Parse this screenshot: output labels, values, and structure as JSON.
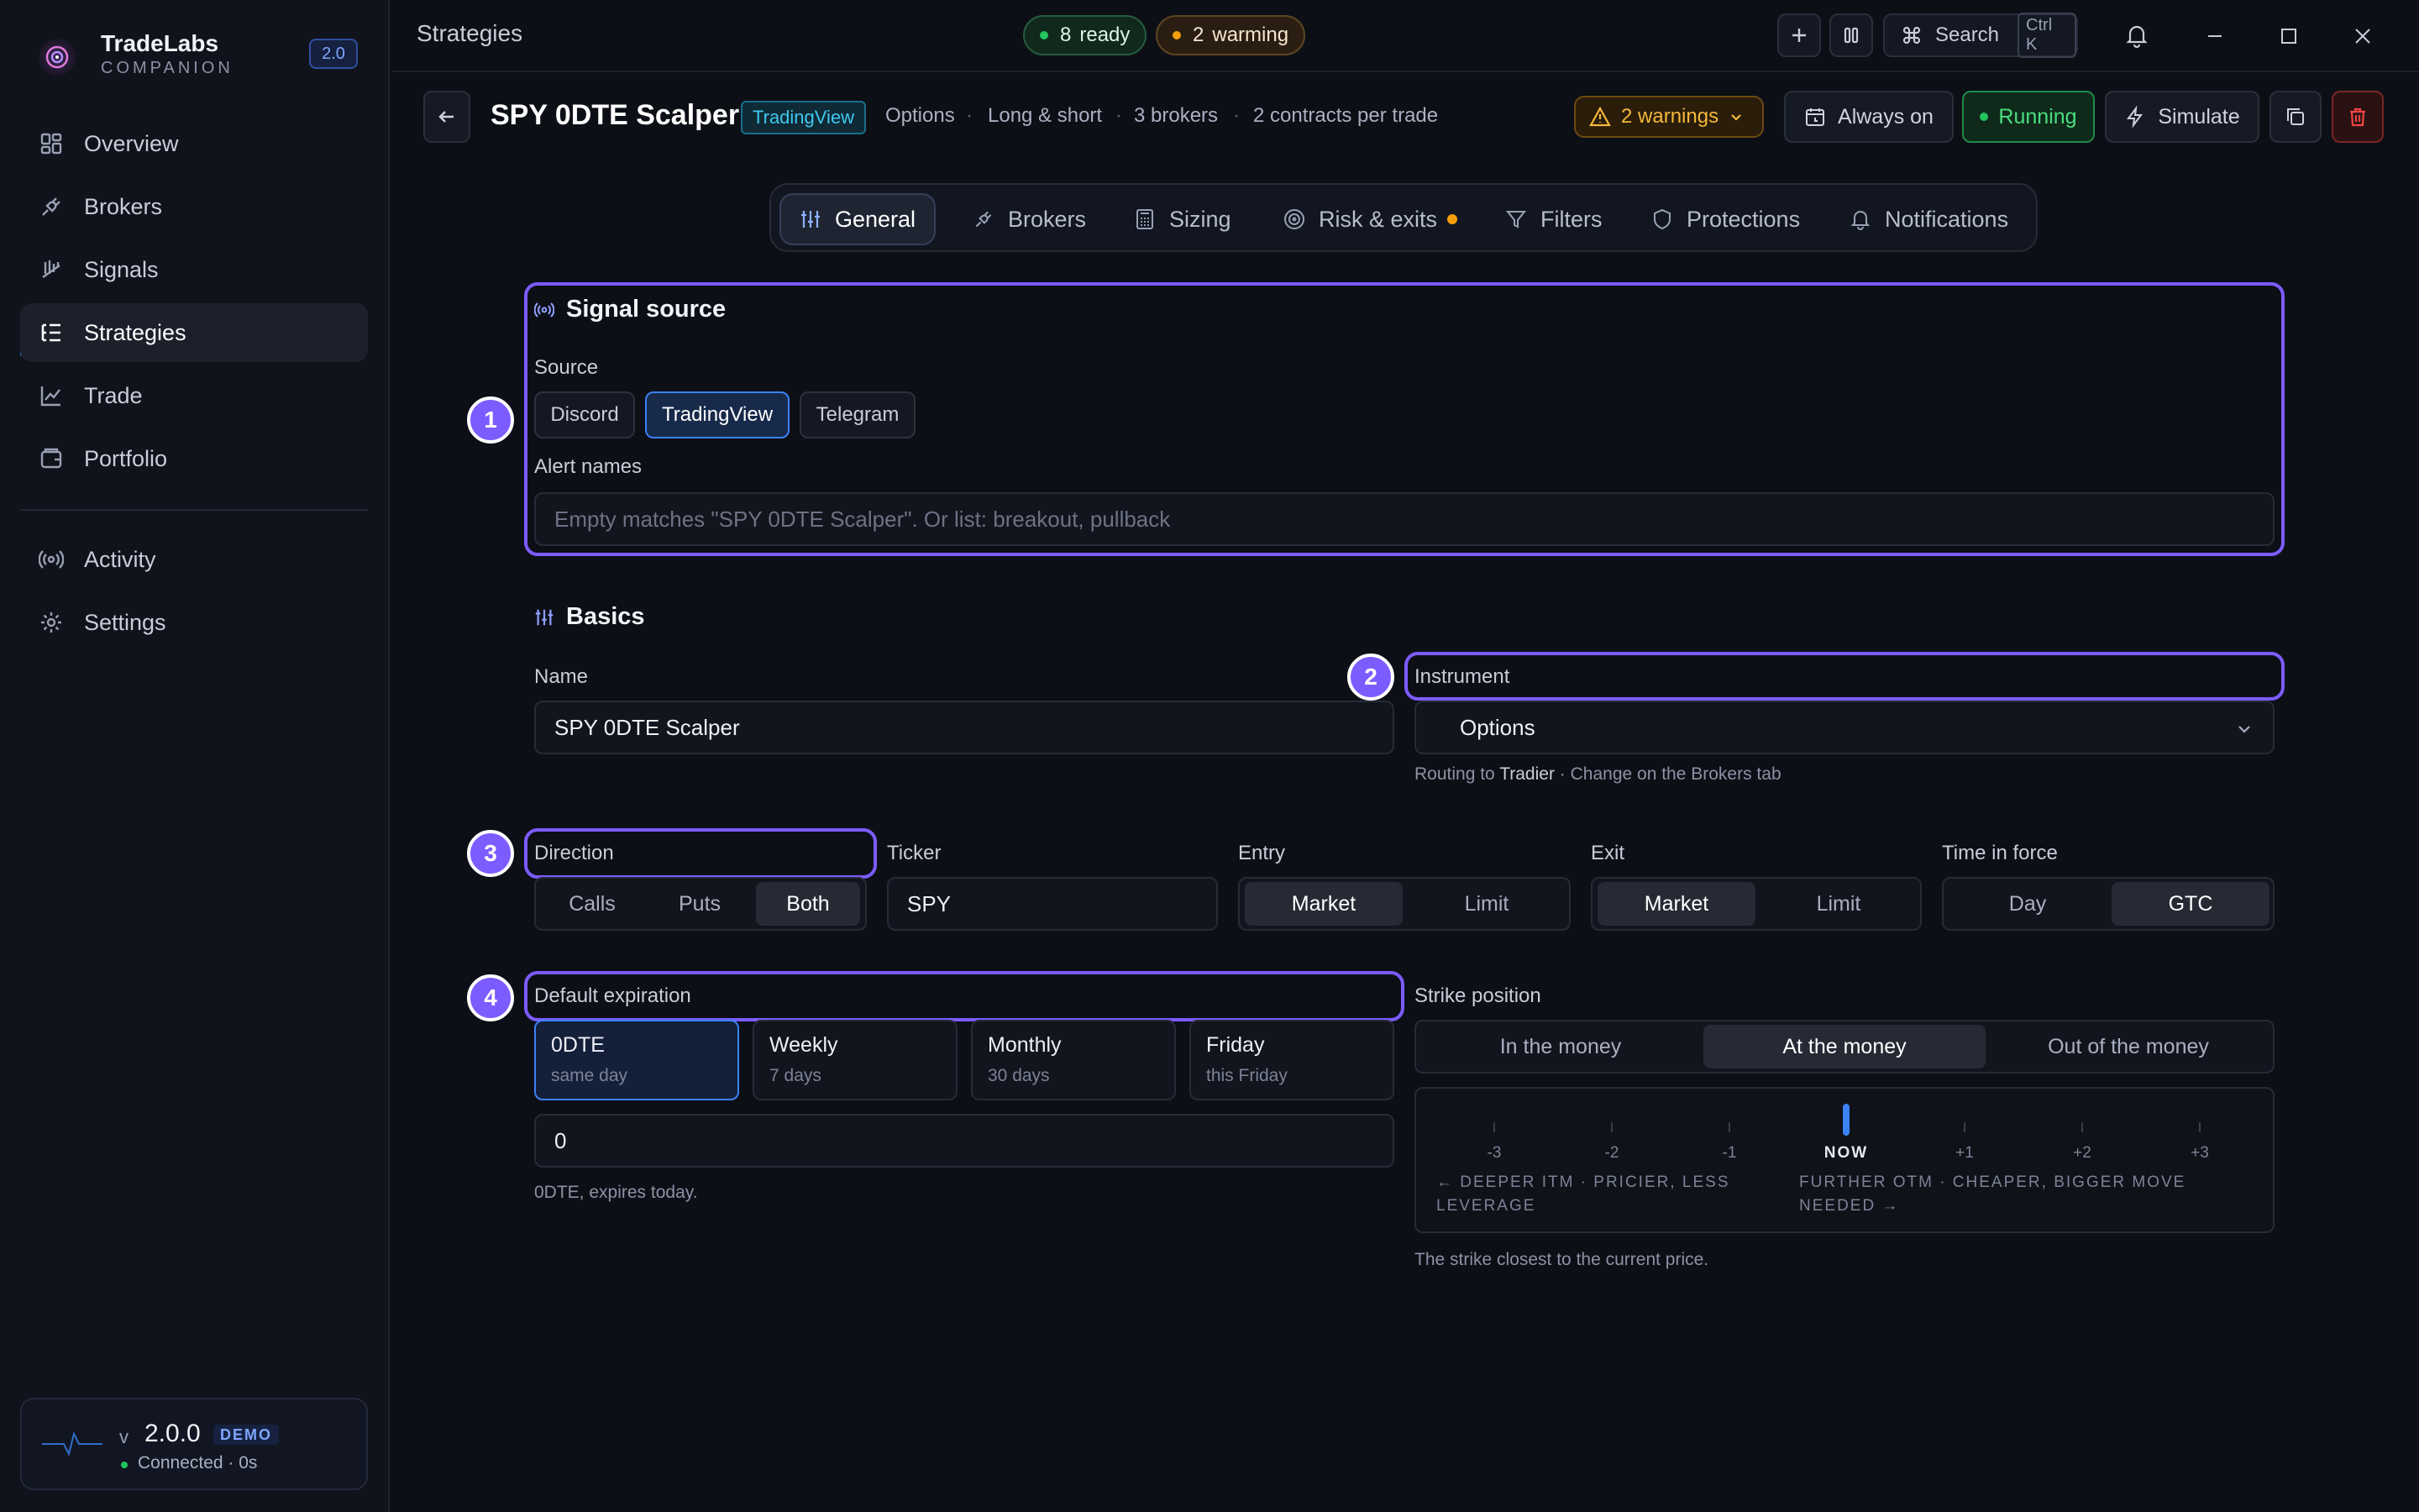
{
  "app": {
    "name": "TradeLabs",
    "subtitle": "COMPANION",
    "version_badge": "2.0"
  },
  "sidebar": {
    "items": [
      {
        "label": "Overview",
        "icon": "grid-icon"
      },
      {
        "label": "Brokers",
        "icon": "plug-icon"
      },
      {
        "label": "Signals",
        "icon": "signal-icon"
      },
      {
        "label": "Strategies",
        "icon": "list-tree-icon",
        "active": true
      },
      {
        "label": "Trade",
        "icon": "chart-line-icon"
      },
      {
        "label": "Portfolio",
        "icon": "wallet-icon"
      },
      {
        "label": "Activity",
        "icon": "broadcast-icon"
      },
      {
        "label": "Settings",
        "icon": "gear-icon"
      }
    ],
    "status": {
      "v_prefix": "v",
      "version": "2.0.0",
      "mode": "DEMO",
      "connection": "Connected · 0s"
    }
  },
  "topbar": {
    "page_title": "Strategies",
    "ready_count": "8",
    "ready_label": "ready",
    "warming_count": "2",
    "warming_label": "warming",
    "search_label": "Search",
    "search_shortcut": "Ctrl K"
  },
  "strategy": {
    "name": "SPY 0DTE Scalper",
    "source_badge": "TradingView",
    "meta": [
      "Options",
      "Long & short",
      "3 brokers",
      "2 contracts per trade"
    ],
    "warnings_label": "2 warnings",
    "schedule_label": "Always on",
    "status_label": "Running",
    "simulate_label": "Simulate"
  },
  "tabs": [
    {
      "label": "General",
      "icon": "sliders-icon",
      "active": true
    },
    {
      "label": "Brokers",
      "icon": "plug-icon"
    },
    {
      "label": "Sizing",
      "icon": "calculator-icon"
    },
    {
      "label": "Risk & exits",
      "icon": "target-icon",
      "dot": true
    },
    {
      "label": "Filters",
      "icon": "filter-icon"
    },
    {
      "label": "Protections",
      "icon": "shield-icon"
    },
    {
      "label": "Notifications",
      "icon": "bell-icon"
    }
  ],
  "signal_source": {
    "title": "Signal source",
    "source_label": "Source",
    "sources": [
      "Discord",
      "TradingView",
      "Telegram"
    ],
    "selected_source": "TradingView",
    "alert_names_label": "Alert names",
    "alert_names_placeholder": "Empty matches \"SPY 0DTE Scalper\". Or list: breakout, pullback"
  },
  "basics": {
    "title": "Basics",
    "name_label": "Name",
    "name_value": "SPY 0DTE Scalper",
    "instrument_label": "Instrument",
    "instrument_value": "Options",
    "routing_prefix": "Routing to",
    "routing_broker": "Tradier",
    "routing_suffix": "· Change on the Brokers tab",
    "direction_label": "Direction",
    "direction_options": [
      "Calls",
      "Puts",
      "Both"
    ],
    "direction_selected": "Both",
    "ticker_label": "Ticker",
    "ticker_value": "SPY",
    "entry_label": "Entry",
    "entry_options": [
      "Market",
      "Limit"
    ],
    "entry_selected": "Market",
    "exit_label": "Exit",
    "exit_options": [
      "Market",
      "Limit"
    ],
    "exit_selected": "Market",
    "tif_label": "Time in force",
    "tif_options": [
      "Day",
      "GTC"
    ],
    "tif_selected": "GTC",
    "expiration_label": "Default expiration",
    "expirations": [
      {
        "title": "0DTE",
        "sub": "same day",
        "selected": true
      },
      {
        "title": "Weekly",
        "sub": "7 days"
      },
      {
        "title": "Monthly",
        "sub": "30 days"
      },
      {
        "title": "Friday",
        "sub": "this Friday"
      }
    ],
    "expiration_days_value": "0",
    "expiration_hint": "0DTE, expires today.",
    "strike_label": "Strike position",
    "strike_options": [
      "In the money",
      "At the money",
      "Out of the money"
    ],
    "strike_selected": "At the money",
    "strike_ticks": [
      "-3",
      "-2",
      "-1",
      "NOW",
      "+1",
      "+2",
      "+3"
    ],
    "strike_left_caption_1": "← DEEPER ITM · PRICIER, LESS",
    "strike_left_caption_2": "LEVERAGE",
    "strike_right_caption_1": "FURTHER OTM · CHEAPER, BIGGER MOVE",
    "strike_right_caption_2": "NEEDED →",
    "strike_hint": "The strike closest to the current price."
  },
  "annotations": [
    "1",
    "2",
    "3",
    "4"
  ],
  "colors": {
    "accent": "#3b82f6",
    "annotation": "#7c5cff",
    "running": "#22c55e",
    "warning": "#f59e0b",
    "danger": "#ef4444"
  }
}
